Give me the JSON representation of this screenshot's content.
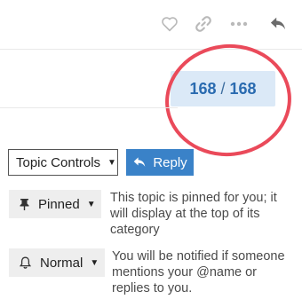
{
  "topic_actions": {
    "icons": [
      "heart-icon",
      "link-icon",
      "more-icon",
      "reply-arrow-icon"
    ]
  },
  "progress": {
    "current": "168",
    "separator": "/",
    "total": "168"
  },
  "controls": {
    "topic_controls_label": "Topic Controls",
    "reply_label": "Reply"
  },
  "notifications": {
    "pinned": {
      "label": "Pinned",
      "description": "This topic is pinned for you; it will display at the top of its category"
    },
    "level": {
      "label": "Normal",
      "description": "You will be notified if someone mentions your @name or replies to you."
    }
  },
  "colors": {
    "accent": "#3a82c8",
    "progress_bg": "#dbe9f7",
    "progress_text": "#2a6bb0",
    "highlight": "#ea4a5a"
  }
}
